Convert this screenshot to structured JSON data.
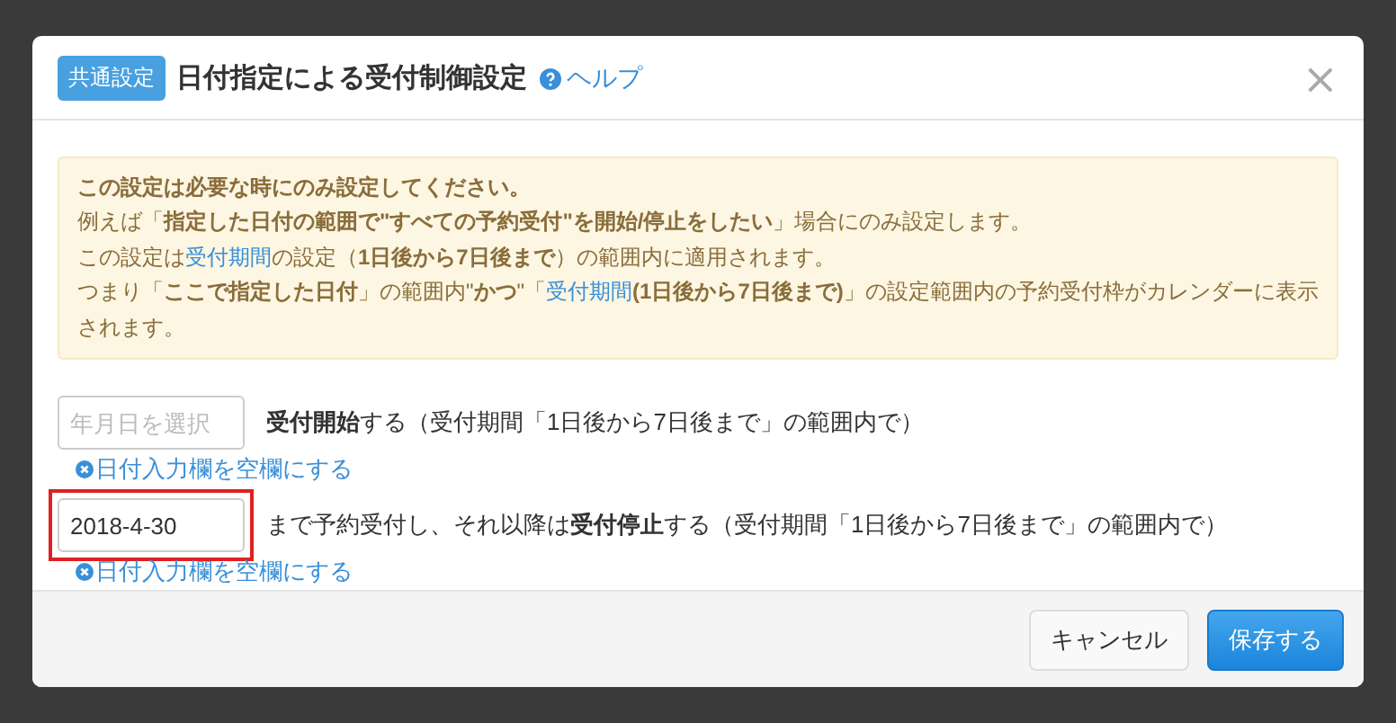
{
  "dialog": {
    "badge": "共通設定",
    "title": "日付指定による受付制御設定",
    "help": "ヘルプ",
    "close": "×"
  },
  "notice": [
    [
      {
        "kind": "bold",
        "text": "この設定は必要な時にのみ設定してください。"
      }
    ],
    [
      {
        "kind": "plain",
        "text": "例えば「"
      },
      {
        "kind": "bold",
        "text": "指定した日付の範囲で\"すべての予約受付\"を開始/停止をしたい"
      },
      {
        "kind": "plain",
        "text": "」場合にのみ設定します。"
      }
    ],
    [
      {
        "kind": "plain",
        "text": "この設定は"
      },
      {
        "kind": "link",
        "text": "受付期間"
      },
      {
        "kind": "plain",
        "text": "の設定（"
      },
      {
        "kind": "bold",
        "text": "1日後から7日後まで"
      },
      {
        "kind": "plain",
        "text": "）の範囲内に適用されます。"
      }
    ],
    [
      {
        "kind": "plain",
        "text": "つまり「"
      },
      {
        "kind": "bold",
        "text": "ここで指定した日付"
      },
      {
        "kind": "plain",
        "text": "」の範囲内\""
      },
      {
        "kind": "bold",
        "text": "かつ"
      },
      {
        "kind": "plain",
        "text": "\"「"
      },
      {
        "kind": "link",
        "text": "受付期間"
      },
      {
        "kind": "bold",
        "text": "(1日後から7日後まで)"
      },
      {
        "kind": "plain",
        "text": "」の設定範囲内の予約受付枠がカレンダーに表示されます。"
      }
    ]
  ],
  "rows": [
    {
      "placeholder": "年月日を選択",
      "highlighted": false,
      "description": "**受付開始**する（受付期間「1日後から7日後まで」の範囲内で）",
      "clear": "日付入力欄を空欄にする"
    },
    {
      "value": "2018-4-30",
      "highlighted": true,
      "description": "まで予約受付し、それ以降は**受付停止**する（受付期間「1日後から7日後まで」の範囲内で）",
      "clear": "日付入力欄を空欄にする"
    }
  ],
  "buttons": [
    {
      "label": "キャンセル",
      "kind": "default"
    },
    {
      "label": "保存する",
      "kind": "primary"
    }
  ]
}
